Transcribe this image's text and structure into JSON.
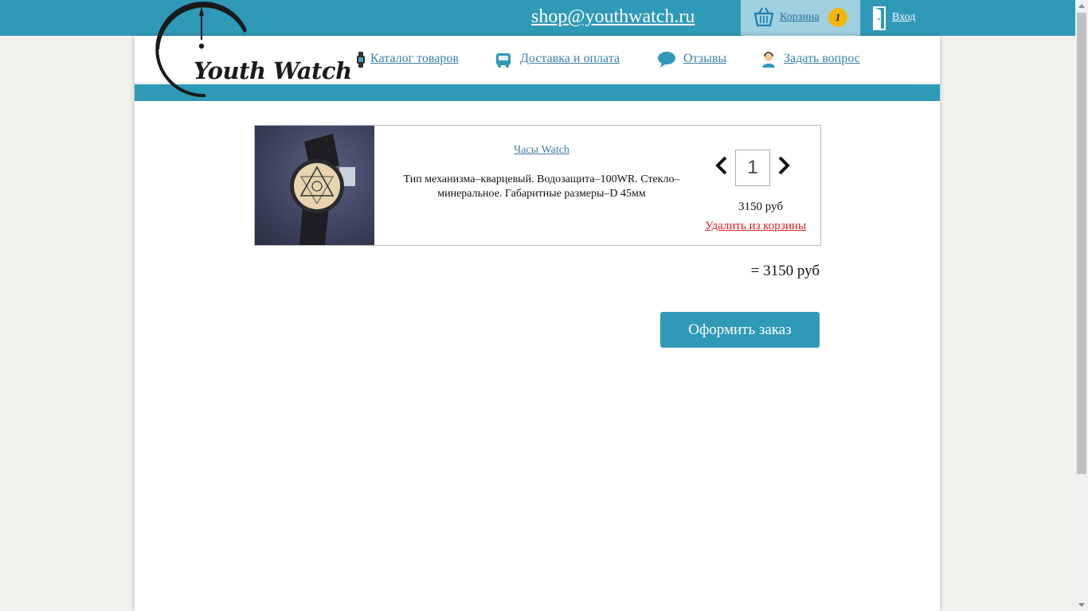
{
  "header": {
    "email": "shop@youthwatch.ru",
    "cart_label": "Корзина",
    "cart_count": "1",
    "login_label": "Вход"
  },
  "logo": {
    "text": "Youth Watch"
  },
  "nav": [
    {
      "label": "Каталог товаров",
      "icon": "watch-icon"
    },
    {
      "label": "Доставка и оплата",
      "icon": "bus-icon"
    },
    {
      "label": "Отзывы",
      "icon": "speech-bubble-icon"
    },
    {
      "label": "Задать вопрос",
      "icon": "support-agent-icon"
    }
  ],
  "cart_item": {
    "name": "Часы Watch",
    "description": "Тип механизма–кварцевый. Водозащита–100WR. Стекло–минеральное. Габаритные размеры–D 45мм",
    "quantity": "1",
    "price": "3150 руб",
    "remove_label": "Удалить из корзины"
  },
  "total": "= 3150 руб",
  "checkout_label": "Оформить заказ",
  "colors": {
    "accent": "#2f99b8",
    "cart_box": "#9ed0df",
    "badge": "#f2b600",
    "link": "#3a7fa8",
    "remove": "#e02020"
  }
}
